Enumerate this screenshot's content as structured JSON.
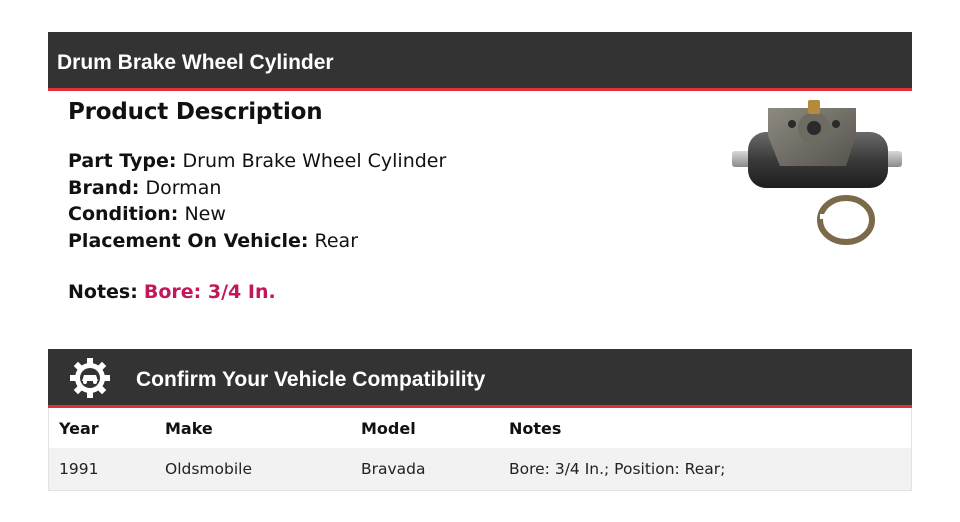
{
  "header": {
    "title": "Drum Brake Wheel Cylinder"
  },
  "description": {
    "heading": "Product Description",
    "specs": [
      {
        "key": "Part Type:",
        "value": "Drum Brake Wheel Cylinder"
      },
      {
        "key": "Brand:",
        "value": "Dorman"
      },
      {
        "key": "Condition:",
        "value": "New"
      },
      {
        "key": "Placement On Vehicle:",
        "value": "Rear"
      }
    ],
    "notes": {
      "key": "Notes:",
      "value": "Bore: 3/4 In."
    }
  },
  "compatibility": {
    "icon": "gear-car-icon",
    "title": "Confirm Your Vehicle Compatibility",
    "columns": [
      "Year",
      "Make",
      "Model",
      "Notes"
    ],
    "rows": [
      [
        "1991",
        "Oldsmobile",
        "Bravada",
        "Bore: 3/4 In.; Position: Rear;"
      ]
    ]
  },
  "colors": {
    "accent": "#e0303a",
    "notes": "#c2185b",
    "bar": "#333333"
  }
}
